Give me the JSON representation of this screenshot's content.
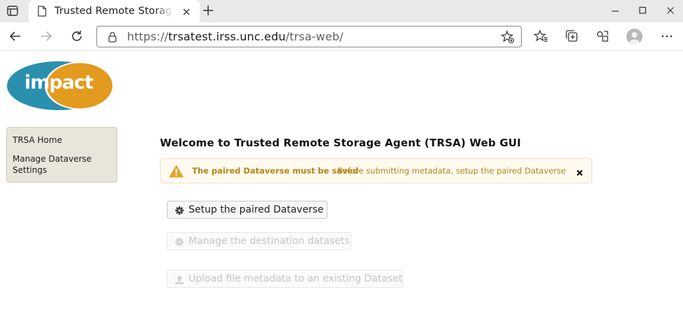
{
  "browser": {
    "tab": {
      "title": "Trusted Remote Storage Agent (TRSA) Web GUI"
    },
    "address": {
      "scheme": "https://",
      "host": "trsatest.irss.unc.edu",
      "path": "/trsa-web/"
    }
  },
  "logo": {
    "text": "impact",
    "color_blue": "#2b8fae",
    "color_orange": "#e29a1f"
  },
  "sidebar": {
    "items": [
      {
        "label": "TRSA Home"
      },
      {
        "label": "Manage Dataverse Settings"
      }
    ]
  },
  "main": {
    "title": "Welcome to Trusted Remote Storage Agent (TRSA) Web GUI",
    "alert": {
      "heading": "The paired Dataverse must be saved",
      "message": "Before submitting metadata, setup the paired Dataverse",
      "icon": "warning-icon",
      "color": "#b58616"
    },
    "buttons": [
      {
        "label": "Setup the paired Dataverse",
        "icon": "gear-icon",
        "enabled": true
      },
      {
        "label": "Manage the destination datasets",
        "icon": "gear-icon",
        "enabled": false
      },
      {
        "label": "Upload file metadata to an existing Dataset",
        "icon": "upload-icon",
        "enabled": false
      }
    ]
  }
}
